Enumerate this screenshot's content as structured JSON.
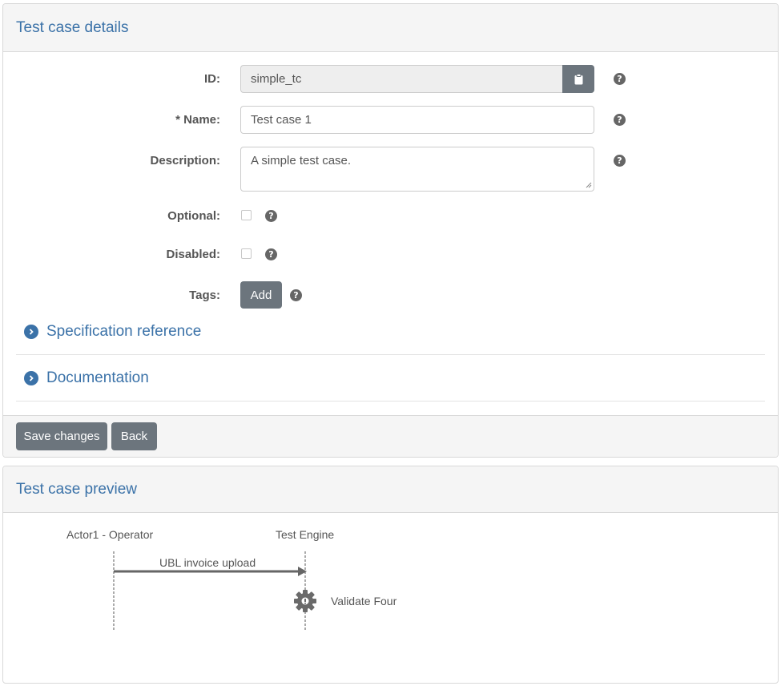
{
  "details": {
    "title": "Test case details",
    "id_label": "ID:",
    "id_value": "simple_tc",
    "name_label": "* Name:",
    "name_value": "Test case 1",
    "description_label": "Description:",
    "description_value": "A simple test case.",
    "optional_label": "Optional:",
    "disabled_label": "Disabled:",
    "tags_label": "Tags:",
    "add_label": "Add",
    "help_glyph": "?",
    "spec_reference": "Specification reference",
    "documentation": "Documentation",
    "save_label": "Save changes",
    "back_label": "Back"
  },
  "preview": {
    "title": "Test case preview",
    "actor1": "Actor1 - Operator",
    "actor2": "Test Engine",
    "message": "UBL invoice upload",
    "step": "Validate Four"
  },
  "icons": [
    "clipboard-icon",
    "help-icon",
    "chevron-right-icon",
    "gear-icon"
  ],
  "colors": {
    "accent": "#3b72a8",
    "button": "#6c757d",
    "panel_heading": "#f5f5f5"
  }
}
